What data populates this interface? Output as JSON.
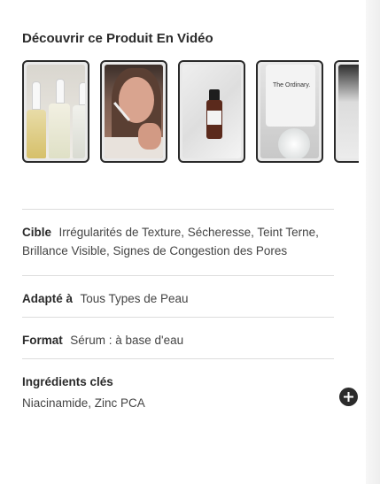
{
  "section": {
    "title": "Découvrir ce Produit En Vidéo"
  },
  "videos": {
    "thumbnails": [
      {
        "name": "video-thumbnail-1"
      },
      {
        "name": "video-thumbnail-2"
      },
      {
        "name": "video-thumbnail-3"
      },
      {
        "name": "video-thumbnail-4"
      },
      {
        "name": "video-thumbnail-5"
      }
    ],
    "brand_text": "The Ordinary."
  },
  "details": {
    "cible": {
      "label": "Cible",
      "value": "Irrégularités de Texture, Sécheresse, Teint Terne, Brillance Visible, Signes de Congestion des Pores"
    },
    "adapte": {
      "label": "Adapté à",
      "value": "Tous Types de Peau"
    },
    "format": {
      "label": "Format",
      "value": "Sérum : à base d'eau"
    },
    "ingredients": {
      "label": "Ingrédients clés",
      "value": "Niacinamide, Zinc PCA",
      "expand_icon": "plus-circle-icon"
    }
  },
  "colors": {
    "text": "#2b2b2b",
    "divider": "#dddddd",
    "button": "#2b2b2b"
  }
}
